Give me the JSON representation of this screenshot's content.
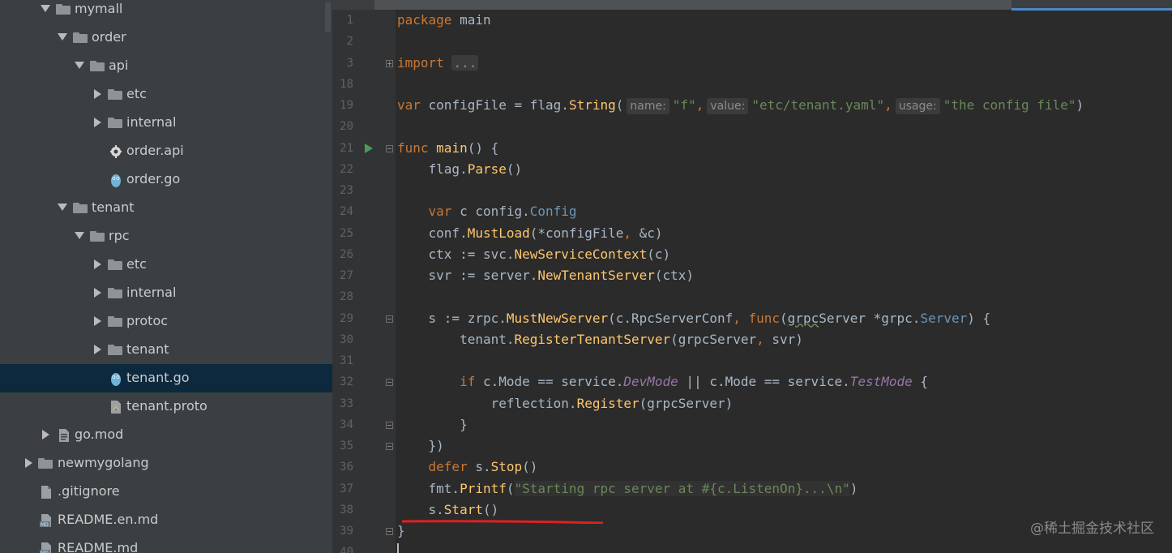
{
  "project_tree": {
    "items": [
      {
        "label": "mymall",
        "kind": "folder",
        "expanded": true,
        "depth": 0,
        "selected": false
      },
      {
        "label": "order",
        "kind": "folder",
        "expanded": true,
        "depth": 1,
        "selected": false
      },
      {
        "label": "api",
        "kind": "folder",
        "expanded": true,
        "depth": 2,
        "selected": false
      },
      {
        "label": "etc",
        "kind": "folder",
        "expanded": false,
        "depth": 3,
        "selected": false
      },
      {
        "label": "internal",
        "kind": "folder",
        "expanded": false,
        "depth": 3,
        "selected": false
      },
      {
        "label": "order.api",
        "kind": "api-file",
        "depth": 3,
        "selected": false
      },
      {
        "label": "order.go",
        "kind": "go-file",
        "depth": 3,
        "selected": false
      },
      {
        "label": "tenant",
        "kind": "folder",
        "expanded": true,
        "depth": 1,
        "selected": false
      },
      {
        "label": "rpc",
        "kind": "folder",
        "expanded": true,
        "depth": 2,
        "selected": false
      },
      {
        "label": "etc",
        "kind": "folder",
        "expanded": false,
        "depth": 3,
        "selected": false
      },
      {
        "label": "internal",
        "kind": "folder",
        "expanded": false,
        "depth": 3,
        "selected": false
      },
      {
        "label": "protoc",
        "kind": "folder",
        "expanded": false,
        "depth": 3,
        "selected": false
      },
      {
        "label": "tenant",
        "kind": "folder",
        "expanded": false,
        "depth": 3,
        "selected": false
      },
      {
        "label": "tenant.go",
        "kind": "go-file",
        "depth": 3,
        "selected": true
      },
      {
        "label": "tenant.proto",
        "kind": "proto-file",
        "depth": 3,
        "selected": false
      },
      {
        "label": "go.mod",
        "kind": "mod-file",
        "expanded": false,
        "depth": 0,
        "selected": false
      },
      {
        "label": "newmygolang",
        "kind": "folder",
        "expanded": false,
        "depth": -1,
        "selected": false
      },
      {
        "label": ".gitignore",
        "kind": "text-file",
        "depth": -1,
        "selected": false
      },
      {
        "label": "README.en.md",
        "kind": "md-file",
        "depth": -1,
        "selected": false
      },
      {
        "label": "README.md",
        "kind": "md-file",
        "depth": -1,
        "selected": false
      }
    ]
  },
  "editor": {
    "lines": [
      {
        "num": "1",
        "tokens": [
          [
            "kw",
            "package"
          ],
          [
            "t",
            " main"
          ]
        ]
      },
      {
        "num": "2",
        "tokens": []
      },
      {
        "num": "3",
        "tokens": [
          [
            "kw",
            "import"
          ],
          [
            "t",
            " "
          ],
          [
            "folded",
            "..."
          ]
        ],
        "fold": "plus"
      },
      {
        "num": "18",
        "tokens": []
      },
      {
        "num": "19",
        "tokens": [
          [
            "kw",
            "var"
          ],
          [
            "t",
            " configFile = flag."
          ],
          [
            "fn",
            "String"
          ],
          [
            "t",
            "("
          ],
          [
            "hint",
            "name:"
          ],
          [
            "str",
            "\"f\""
          ],
          [
            "kw",
            ","
          ],
          [
            "hint",
            "value:"
          ],
          [
            "str",
            "\"etc/tenant.yaml\""
          ],
          [
            "kw",
            ","
          ],
          [
            "hint",
            "usage:"
          ],
          [
            "str",
            "\"the config file\""
          ],
          [
            "t",
            ")"
          ]
        ]
      },
      {
        "num": "20",
        "tokens": []
      },
      {
        "num": "21",
        "tokens": [
          [
            "kw",
            "func"
          ],
          [
            "t",
            " "
          ],
          [
            "fn",
            "main"
          ],
          [
            "t",
            "() {"
          ]
        ],
        "fold": "minus",
        "run": true
      },
      {
        "num": "22",
        "tokens": [
          [
            "t",
            "    flag."
          ],
          [
            "fn",
            "Parse"
          ],
          [
            "t",
            "()"
          ]
        ]
      },
      {
        "num": "23",
        "tokens": []
      },
      {
        "num": "24",
        "tokens": [
          [
            "t",
            "    "
          ],
          [
            "kw",
            "var"
          ],
          [
            "t",
            " c config."
          ],
          [
            "ty",
            "Config"
          ]
        ]
      },
      {
        "num": "25",
        "tokens": [
          [
            "t",
            "    conf."
          ],
          [
            "fn",
            "MustLoad"
          ],
          [
            "t",
            "(*configFile"
          ],
          [
            "kw",
            ","
          ],
          [
            "t",
            " &c)"
          ]
        ]
      },
      {
        "num": "26",
        "tokens": [
          [
            "t",
            "    ctx := svc."
          ],
          [
            "fn",
            "NewServiceContext"
          ],
          [
            "t",
            "(c)"
          ]
        ]
      },
      {
        "num": "27",
        "tokens": [
          [
            "t",
            "    svr := server."
          ],
          [
            "fn",
            "NewTenantServer"
          ],
          [
            "t",
            "(ctx)"
          ]
        ]
      },
      {
        "num": "28",
        "tokens": []
      },
      {
        "num": "29",
        "tokens": [
          [
            "t",
            "    s := zrpc."
          ],
          [
            "fn",
            "MustNewServer"
          ],
          [
            "t",
            "(c.RpcServerConf"
          ],
          [
            "kw",
            ","
          ],
          [
            "t",
            " "
          ],
          [
            "kw",
            "func"
          ],
          [
            "t",
            "("
          ],
          [
            "wavy",
            "grpc"
          ],
          [
            "t",
            "Server *grpc."
          ],
          [
            "ty",
            "Server"
          ],
          [
            "t",
            ") {"
          ]
        ],
        "fold": "minus"
      },
      {
        "num": "30",
        "tokens": [
          [
            "t",
            "        tenant."
          ],
          [
            "fn",
            "RegisterTenantServer"
          ],
          [
            "t",
            "(grpcServer"
          ],
          [
            "kw",
            ","
          ],
          [
            "t",
            " svr)"
          ]
        ]
      },
      {
        "num": "31",
        "tokens": []
      },
      {
        "num": "32",
        "tokens": [
          [
            "t",
            "        "
          ],
          [
            "kw",
            "if"
          ],
          [
            "t",
            " c.Mode == service."
          ],
          [
            "cst",
            "DevMode"
          ],
          [
            "t",
            " || c.Mode == service."
          ],
          [
            "cst",
            "TestMode"
          ],
          [
            "t",
            " {"
          ]
        ],
        "fold": "minus"
      },
      {
        "num": "33",
        "tokens": [
          [
            "t",
            "            reflection."
          ],
          [
            "fn",
            "Register"
          ],
          [
            "t",
            "(grpcServer)"
          ]
        ]
      },
      {
        "num": "34",
        "tokens": [
          [
            "t",
            "        }"
          ]
        ],
        "fold": "end"
      },
      {
        "num": "35",
        "tokens": [
          [
            "t",
            "    })"
          ]
        ],
        "fold": "end"
      },
      {
        "num": "36",
        "tokens": [
          [
            "t",
            "    "
          ],
          [
            "kw",
            "defer"
          ],
          [
            "t",
            " s."
          ],
          [
            "fn",
            "Stop"
          ],
          [
            "t",
            "()"
          ]
        ]
      },
      {
        "num": "37",
        "tokens": [
          [
            "t",
            "    fmt."
          ],
          [
            "fn",
            "Printf"
          ],
          [
            "t",
            "("
          ],
          [
            "fmtstr",
            "\"Starting rpc server at #{c.ListenOn}...\\n\""
          ],
          [
            "t",
            ")"
          ]
        ]
      },
      {
        "num": "38",
        "tokens": [
          [
            "t",
            "    s."
          ],
          [
            "fn",
            "Start"
          ],
          [
            "t",
            "()"
          ]
        ]
      },
      {
        "num": "39",
        "tokens": [
          [
            "t",
            "}"
          ]
        ],
        "fold": "end"
      },
      {
        "num": "40",
        "tokens": []
      }
    ]
  },
  "watermark": "@稀土掘金技术社区",
  "colors": {
    "tree_bg": "#3c3f41",
    "selection": "#0d293e",
    "editor_bg": "#2b2b2b",
    "gutter_bg": "#313335",
    "keyword": "#cc7832",
    "function": "#ffc66d",
    "type": "#6897bb",
    "string": "#6a8759",
    "constant": "#9876aa",
    "annotation_red": "#e02020"
  }
}
